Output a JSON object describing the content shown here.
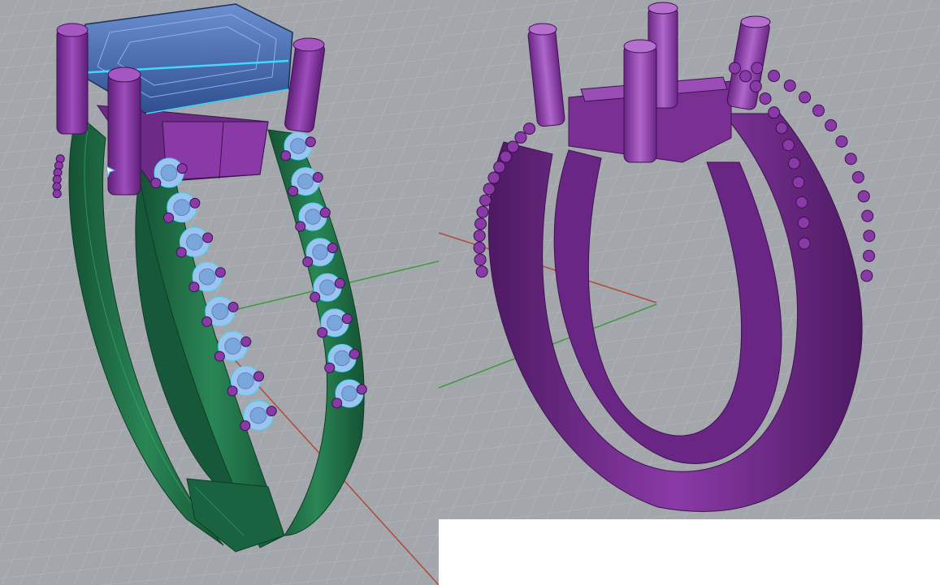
{
  "app": {
    "viewports": [
      {
        "id": "left",
        "model": "split-shank-ring-rendered",
        "display_mode": "rendered"
      },
      {
        "id": "right",
        "model": "split-shank-ring-metal-only",
        "display_mode": "rendered"
      }
    ]
  },
  "colors": {
    "viewport_bg": "#a3a7ab",
    "grid_minor": "#b3b7bb",
    "grid_major": "#8f9397",
    "axis_x": "#b04a3a",
    "axis_y": "#3f9a3a",
    "metal_green": "#1f6e45",
    "metal_green_dark": "#124a2d",
    "metal_purple": "#7a2f93",
    "metal_purple_dark": "#4e1a63",
    "gem_blue": "#3e64a8",
    "gem_highlight": "#3fd8ff",
    "accent_stone": "#9cc4ee"
  },
  "icons": {
    "gumball": "cursor-arrow-icon"
  }
}
